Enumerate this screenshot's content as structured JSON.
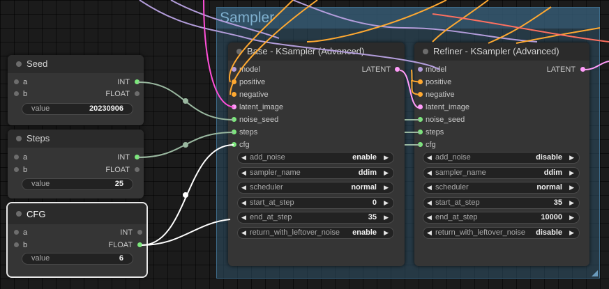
{
  "group": {
    "title": "Sampler"
  },
  "seed": {
    "title": "Seed",
    "in_a": "a",
    "in_b": "b",
    "out_int": "INT",
    "out_float": "FLOAT",
    "widget_label": "value",
    "widget_value": "20230906"
  },
  "steps": {
    "title": "Steps",
    "in_a": "a",
    "in_b": "b",
    "out_int": "INT",
    "out_float": "FLOAT",
    "widget_label": "value",
    "widget_value": "25"
  },
  "cfg": {
    "title": "CFG",
    "in_a": "a",
    "in_b": "b",
    "out_int": "INT",
    "out_float": "FLOAT",
    "widget_label": "value",
    "widget_value": "6"
  },
  "base": {
    "title": "Base - KSampler (Advanced)",
    "inputs": [
      "model",
      "positive",
      "negative",
      "latent_image",
      "noise_seed",
      "steps",
      "cfg"
    ],
    "output": "LATENT",
    "widgets": [
      {
        "label": "add_noise",
        "value": "enable"
      },
      {
        "label": "sampler_name",
        "value": "ddim"
      },
      {
        "label": "scheduler",
        "value": "normal"
      },
      {
        "label": "start_at_step",
        "value": "0"
      },
      {
        "label": "end_at_step",
        "value": "35"
      },
      {
        "label": "return_with_leftover_noise",
        "value": "enable"
      }
    ]
  },
  "refiner": {
    "title": "Refiner - KSampler (Advanced)",
    "inputs": [
      "model",
      "positive",
      "negative",
      "latent_image",
      "noise_seed",
      "steps",
      "cfg"
    ],
    "output": "LATENT",
    "widgets": [
      {
        "label": "add_noise",
        "value": "disable"
      },
      {
        "label": "sampler_name",
        "value": "ddim"
      },
      {
        "label": "scheduler",
        "value": "normal"
      },
      {
        "label": "start_at_step",
        "value": "35"
      },
      {
        "label": "end_at_step",
        "value": "10000"
      },
      {
        "label": "return_with_leftover_noise",
        "value": "disable"
      }
    ]
  },
  "socket_colors": {
    "model": "#b39ddb",
    "positive": "#ffa931",
    "negative": "#ffa931",
    "latent_image": "#ff9cf9",
    "noise_seed": "#7ce87c",
    "steps": "#7ce87c",
    "cfg": "#7ce87c",
    "latent_out": "#ff9cf9",
    "int": "#7ce87c"
  }
}
